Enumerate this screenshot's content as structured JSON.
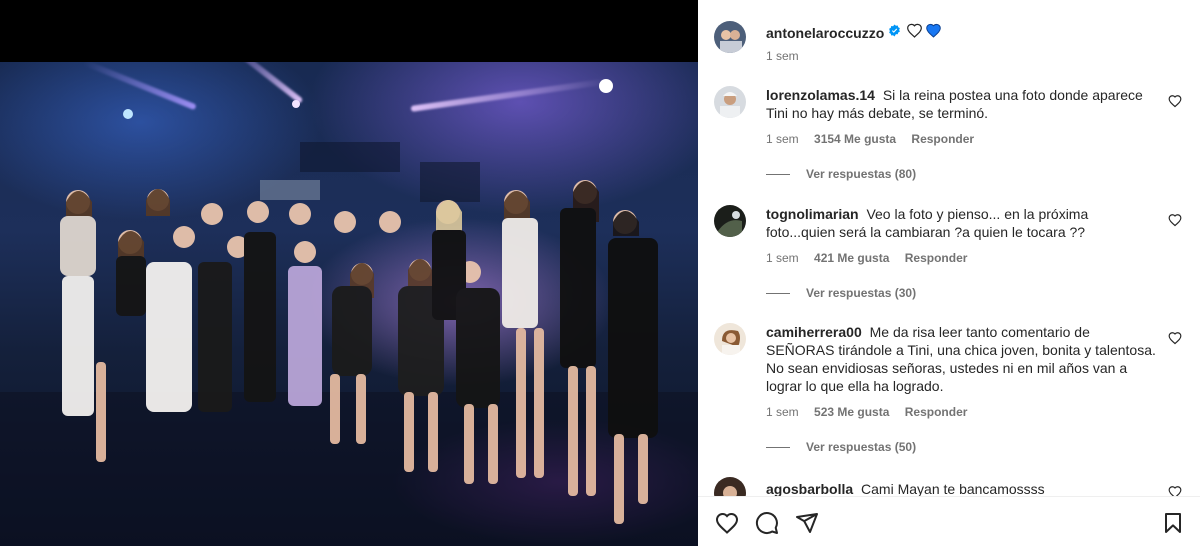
{
  "post": {
    "author": "antonelaroccuzzo",
    "time": "1 sem",
    "verified_icon": "verified-badge-icon",
    "caption_emojis": [
      "white-heart-icon",
      "blue-heart-icon"
    ]
  },
  "comments": [
    {
      "username": "lorenzolamas.14",
      "text": "Si la reina postea una foto donde aparece Tini no hay más debate, se terminó.",
      "time": "1 sem",
      "likes": "3154 Me gusta",
      "reply": "Responder",
      "replies": "Ver respuestas (80)"
    },
    {
      "username": "tognolimarian",
      "text": "Veo la foto y pienso... en la próxima foto...quien será la cambiaran ?a quien le tocara ??",
      "time": "1 sem",
      "likes": "421 Me gusta",
      "reply": "Responder",
      "replies": "Ver respuestas (30)"
    },
    {
      "username": "camiherrera00",
      "text": "Me da risa leer tanto comentario de SEÑORAS tirándole a Tini, una chica joven, bonita y talentosa. No sean envidiosas señoras, ustedes ni en mil años van a lograr lo que ella ha logrado.",
      "time": "1 sem",
      "likes": "523 Me gusta",
      "reply": "Responder",
      "replies": "Ver respuestas (50)"
    },
    {
      "username": "agosbarbolla",
      "text": "Cami Mayan te bancamossss"
    }
  ],
  "actions": {
    "like_icon": "heart-icon",
    "comment_icon": "comment-icon",
    "share_icon": "send-icon",
    "save_icon": "bookmark-icon"
  },
  "colors": {
    "verified": "#0095f6",
    "blue_heart": "#1877f2",
    "text": "#262626",
    "muted": "#737373"
  }
}
